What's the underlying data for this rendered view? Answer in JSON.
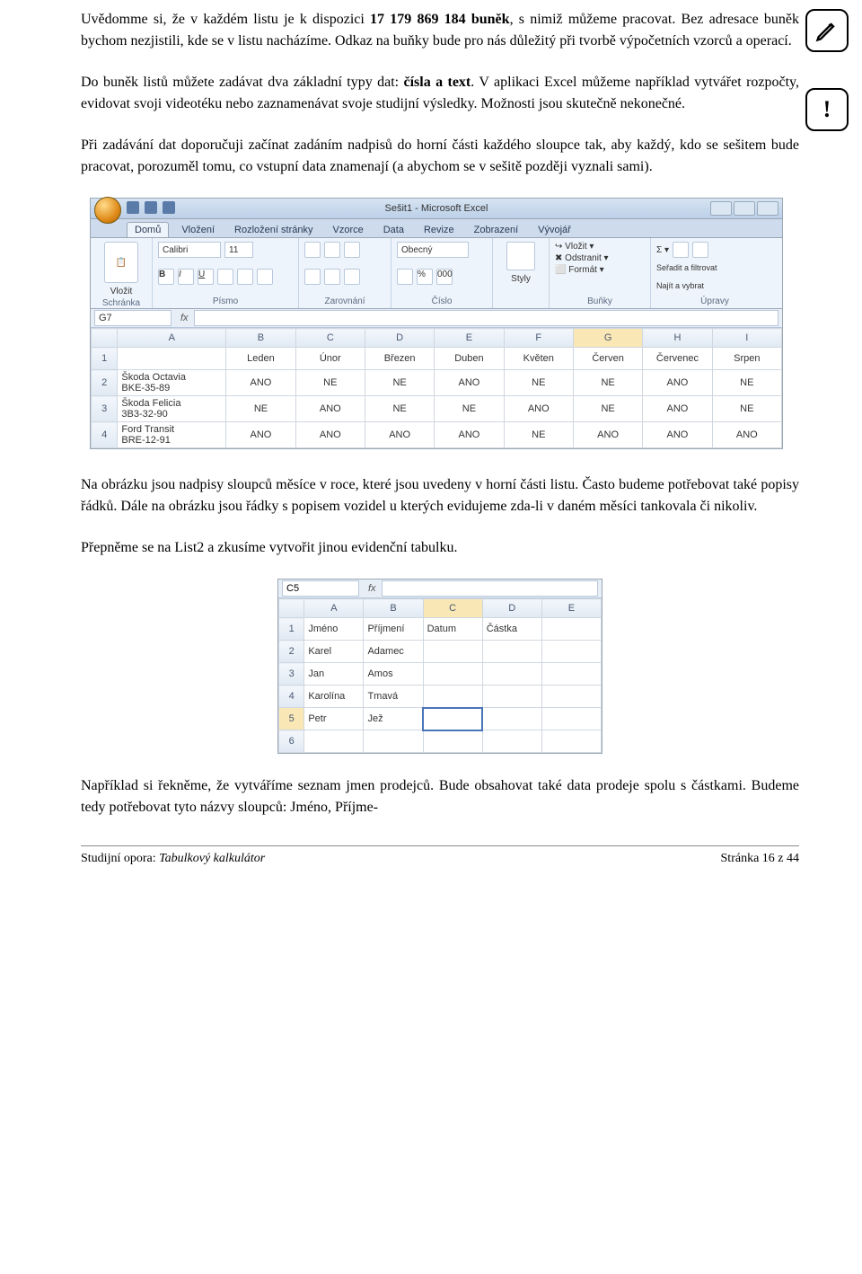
{
  "para1_a": "Uvědomme si, že v každém listu je k dispozici ",
  "para1_b": "17 179 869 184 buněk",
  "para1_c": ", s nimiž můžeme pracovat. Bez adresace buněk bychom nezjistili, kde se v listu nacházíme. Odkaz na buňky bude pro nás důležitý při tvorbě výpočetních vzorců a operací.",
  "para2_a": "Do buněk listů můžete zadávat dva základní typy dat: ",
  "para2_b": "čísla a text",
  "para2_c": ". V aplikaci Excel můžeme například vytvářet rozpočty, evidovat svoji videotéku nebo zaznamenávat svoje studijní výsledky. Možnosti jsou skutečně nekonečné.",
  "para3": "Při zadávání dat doporučuji začínat zadáním nadpisů do horní části každého sloupce tak, aby každý, kdo se sešitem bude pracovat, porozuměl tomu, co vstupní data znamenají (a abychom se v sešitě později vyznali sami).",
  "para4": "Na obrázku jsou nadpisy sloupců měsíce v roce, které jsou uvedeny v horní části listu. Často budeme potřebovat také popisy řádků. Dále na obrázku jsou řádky s popisem vozidel u kterých evidujeme zda-li v daném měsíci tankovala či nikoliv.",
  "para5": "Přepněme se na List2 a zkusíme vytvořit jinou evidenční tabulku.",
  "para6": "Například si řekněme, že vytváříme seznam jmen prodejců. Bude obsahovat také data prodeje spolu s částkami. Budeme tedy  potřebovat tyto názvy sloupců: Jméno, Příjme-",
  "footer_left_a": "Studijní opora: ",
  "footer_left_b": "Tabulkový kalkulátor",
  "footer_right": "Stránka 16 z 44",
  "shot1": {
    "title": "Sešit1 - Microsoft Excel",
    "tabs": [
      "Domů",
      "Vložení",
      "Rozložení stránky",
      "Vzorce",
      "Data",
      "Revize",
      "Zobrazení",
      "Vývojář"
    ],
    "groups": {
      "clipboard": "Schránka",
      "paste": "Vložit",
      "font": "Písmo",
      "align": "Zarovnání",
      "number": "Číslo",
      "styles": "Styly",
      "cells": "Buňky",
      "editing": "Úpravy",
      "font_name": "Calibri",
      "font_size": "11",
      "num_fmt": "Obecný",
      "insert": "Vložit",
      "delete": "Odstranit",
      "format": "Formát",
      "sort": "Seřadit a filtrovat",
      "find": "Najít a vybrat"
    },
    "namebox": "G7",
    "cols": [
      "A",
      "B",
      "C",
      "D",
      "E",
      "F",
      "G",
      "H",
      "I"
    ],
    "months": [
      "Leden",
      "Únor",
      "Březen",
      "Duben",
      "Květen",
      "Červen",
      "Červenec",
      "Srpen"
    ],
    "rows": [
      {
        "num": "2",
        "label_a": "Škoda Octavia",
        "label_b": "BKE-35-89",
        "vals": [
          "ANO",
          "NE",
          "NE",
          "ANO",
          "NE",
          "NE",
          "ANO",
          "NE"
        ]
      },
      {
        "num": "3",
        "label_a": "Škoda Felicia",
        "label_b": "3B3-32-90",
        "vals": [
          "NE",
          "ANO",
          "NE",
          "NE",
          "ANO",
          "NE",
          "ANO",
          "NE"
        ]
      },
      {
        "num": "4",
        "label_a": "Ford Transit",
        "label_b": "BRE-12-91",
        "vals": [
          "ANO",
          "ANO",
          "ANO",
          "ANO",
          "NE",
          "ANO",
          "ANO",
          "ANO"
        ]
      }
    ]
  },
  "shot2": {
    "namebox": "C5",
    "cols": [
      "A",
      "B",
      "C",
      "D",
      "E"
    ],
    "headers": [
      "Jméno",
      "Příjmení",
      "Datum",
      "Částka"
    ],
    "rows": [
      {
        "num": "2",
        "vals": [
          "Karel",
          "Adamec",
          "",
          ""
        ]
      },
      {
        "num": "3",
        "vals": [
          "Jan",
          "Amos",
          "",
          ""
        ]
      },
      {
        "num": "4",
        "vals": [
          "Karolína",
          "Tmavá",
          "",
          ""
        ]
      },
      {
        "num": "5",
        "vals": [
          "Petr",
          "Jež",
          "",
          ""
        ]
      },
      {
        "num": "6",
        "vals": [
          "",
          "",
          "",
          ""
        ]
      }
    ]
  }
}
